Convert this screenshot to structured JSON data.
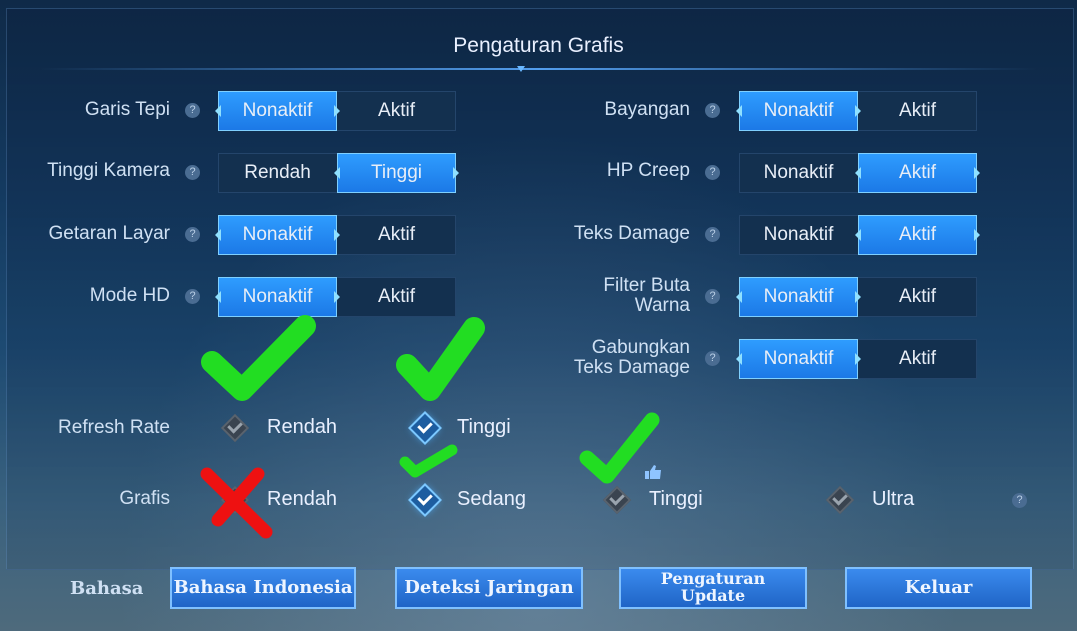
{
  "title": "Pengaturan Grafis",
  "help_glyph": "?",
  "settings_left": [
    {
      "label": "Garis Tepi",
      "options": [
        "Nonaktif",
        "Aktif"
      ],
      "selected": 0
    },
    {
      "label": "Tinggi Kamera",
      "options": [
        "Rendah",
        "Tinggi"
      ],
      "selected": 1
    },
    {
      "label": "Getaran Layar",
      "options": [
        "Nonaktif",
        "Aktif"
      ],
      "selected": 0
    },
    {
      "label": "Mode HD",
      "options": [
        "Nonaktif",
        "Aktif"
      ],
      "selected": 0
    }
  ],
  "settings_right": [
    {
      "label": "Bayangan",
      "options": [
        "Nonaktif",
        "Aktif"
      ],
      "selected": 0
    },
    {
      "label": "HP Creep",
      "options": [
        "Nonaktif",
        "Aktif"
      ],
      "selected": 1
    },
    {
      "label": "Teks Damage",
      "options": [
        "Nonaktif",
        "Aktif"
      ],
      "selected": 1
    },
    {
      "label": "Filter Buta Warna",
      "label_lines": [
        "Filter Buta",
        "Warna"
      ],
      "options": [
        "Nonaktif",
        "Aktif"
      ],
      "selected": 0
    },
    {
      "label": "Gabungkan Teks Damage",
      "label_lines": [
        "Gabungkan",
        "Teks Damage"
      ],
      "options": [
        "Nonaktif",
        "Aktif"
      ],
      "selected": 0
    }
  ],
  "refresh_rate": {
    "label": "Refresh Rate",
    "options": [
      "Rendah",
      "Tinggi"
    ],
    "selected": 1
  },
  "grafis": {
    "label": "Grafis",
    "options": [
      "Rendah",
      "Sedang",
      "Tinggi",
      "Ultra"
    ],
    "selected": 1,
    "recommended": 2
  },
  "footer": {
    "bahasa_label": "Bahasa",
    "language_button": "Bahasa Indonesia",
    "network_button": "Deteksi Jaringan",
    "update_button_lines": [
      "Pengaturan",
      "Update"
    ],
    "exit_button": "Keluar"
  },
  "colors": {
    "check_mark": "#22dd22",
    "cross_mark": "#ee1111",
    "accent": "#2a8cf5"
  }
}
